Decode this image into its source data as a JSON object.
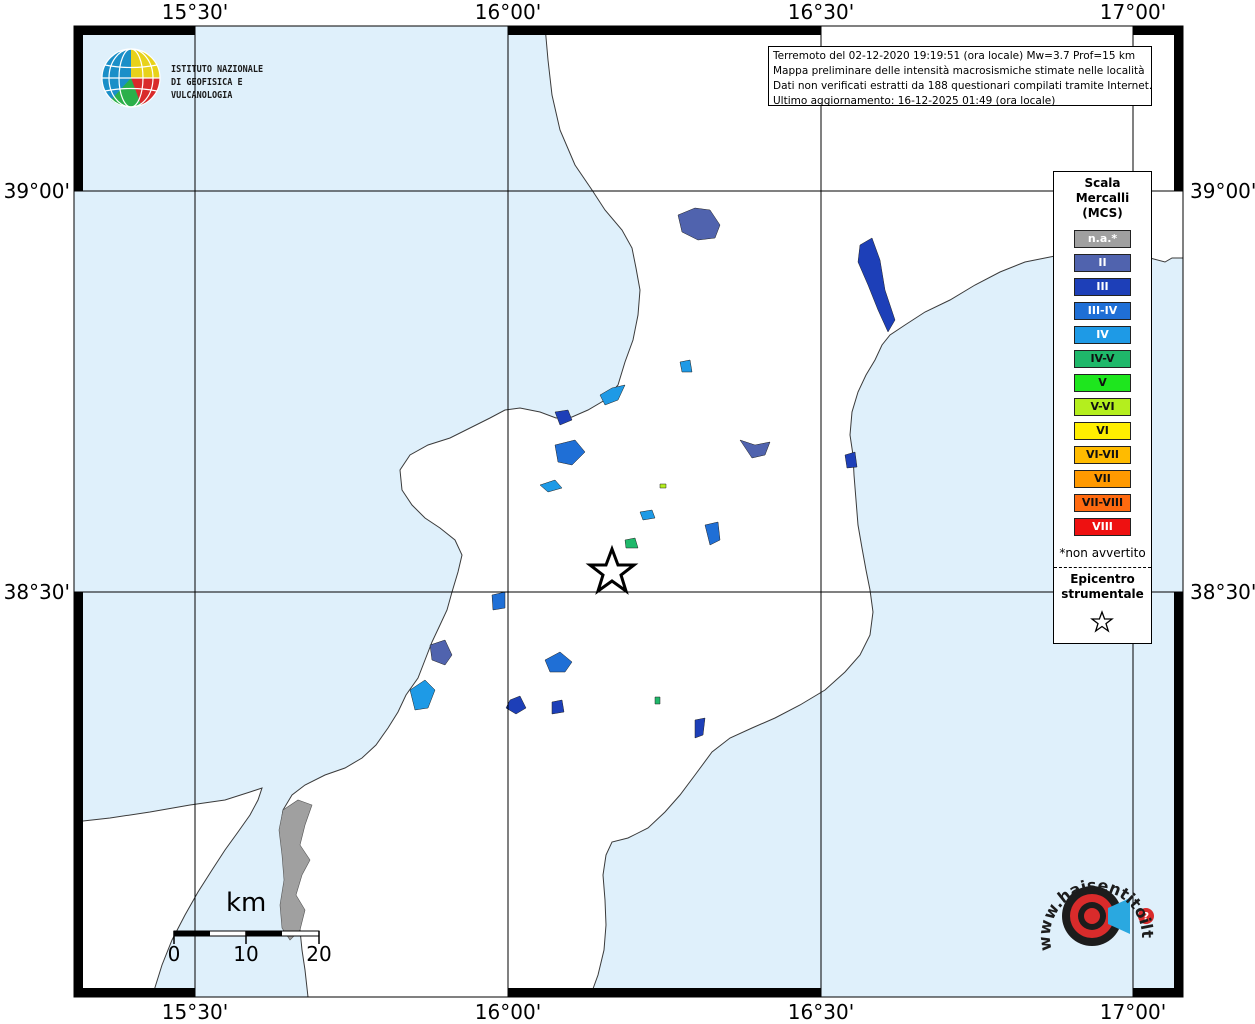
{
  "map": {
    "lat_labels": [
      "39°00'",
      "38°30'"
    ],
    "lon_labels": [
      "15°30'",
      "16°00'",
      "16°30'",
      "17°00'"
    ],
    "colors": {
      "sea": "#dff0fb",
      "land": "#ffffff",
      "grid": "#000000",
      "frame": "#000000"
    }
  },
  "logo": {
    "line1": "ISTITUTO NAZIONALE",
    "line2": "DI GEOFISICA E VULCANOLOGIA",
    "icon": "ingv-globe-icon"
  },
  "info": {
    "line1": "Terremoto del 02-12-2020 19:19:51 (ora locale) Mw=3.7 Prof=15 km",
    "line2": "Mappa preliminare delle intensità macrosismiche stimate nelle località",
    "line3": "Dati non verificati estratti da 188 questionari compilati tramite Internet.",
    "line4": "Ultimo aggiornamento: 16-12-2025 01:49 (ora locale)"
  },
  "legend": {
    "title": "Scala\nMercalli\n(MCS)",
    "items": [
      {
        "label": "n.a.*",
        "color": "#a0a0a0",
        "text_color": "#ffffff"
      },
      {
        "label": "II",
        "color": "#5063ae",
        "text_color": "#ffffff"
      },
      {
        "label": "III",
        "color": "#1d3fb8",
        "text_color": "#ffffff"
      },
      {
        "label": "III-IV",
        "color": "#1f6fd6",
        "text_color": "#ffffff"
      },
      {
        "label": "IV",
        "color": "#1e9ae6",
        "text_color": "#ffffff"
      },
      {
        "label": "IV-V",
        "color": "#1fb86a",
        "text_color": "#111111"
      },
      {
        "label": "V",
        "color": "#1ee61e",
        "text_color": "#111111"
      },
      {
        "label": "V-VI",
        "color": "#b4ee1e",
        "text_color": "#111111"
      },
      {
        "label": "VI",
        "color": "#ffee00",
        "text_color": "#111111"
      },
      {
        "label": "VI-VII",
        "color": "#ffbb00",
        "text_color": "#111111"
      },
      {
        "label": "VII",
        "color": "#ff9900",
        "text_color": "#111111"
      },
      {
        "label": "VII-VIII",
        "color": "#ff6a10",
        "text_color": "#111111"
      },
      {
        "label": "VIII",
        "color": "#ee1111",
        "text_color": "#ffffff"
      }
    ],
    "note": "*non avvertito",
    "epicenter_label": "Epicentro\nstrumentale",
    "epicenter_icon": "star-icon"
  },
  "scalebar": {
    "title": "km",
    "ticks": [
      "0",
      "10",
      "20"
    ]
  },
  "haisentito": {
    "text": "www.haisentitoilterremoto.it",
    "icon": "haisentito-logo-icon"
  }
}
